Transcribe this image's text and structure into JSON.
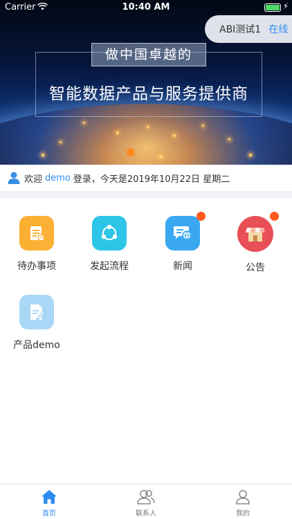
{
  "status_bar": {
    "carrier": "Carrier",
    "time": "10:40 AM"
  },
  "user_pill": {
    "name": "ABI测试1",
    "status": "在线"
  },
  "banner": {
    "tag": "做中国卓越的",
    "title": "智能数据产品与服务提供商"
  },
  "welcome": {
    "prefix": "欢迎",
    "user": "demo",
    "suffix": "登录，今天是2019年10月22日 星期二"
  },
  "grid": [
    {
      "label": "待办事项",
      "icon": "todo-icon",
      "color": "#fbb034",
      "badge": false
    },
    {
      "label": "发起流程",
      "icon": "share-flow-icon",
      "color": "#2ec6e8",
      "badge": false
    },
    {
      "label": "新闻",
      "icon": "news-icon",
      "color": "#3aa8f0",
      "badge": true
    },
    {
      "label": "公告",
      "icon": "announcement-icon",
      "color": "#e84f56",
      "badge": true
    },
    {
      "label": "产品demo",
      "icon": "product-demo-icon",
      "color": "#a9d8f7",
      "badge": false
    }
  ],
  "tabs": [
    {
      "label": "首页",
      "icon": "home-icon",
      "active": true
    },
    {
      "label": "联系人",
      "icon": "contacts-icon",
      "active": false
    },
    {
      "label": "我的",
      "icon": "profile-icon",
      "active": false
    }
  ],
  "colors": {
    "accent": "#2d8cf0",
    "badge": "#ff5a1f",
    "divider": "#f0f1f5"
  }
}
